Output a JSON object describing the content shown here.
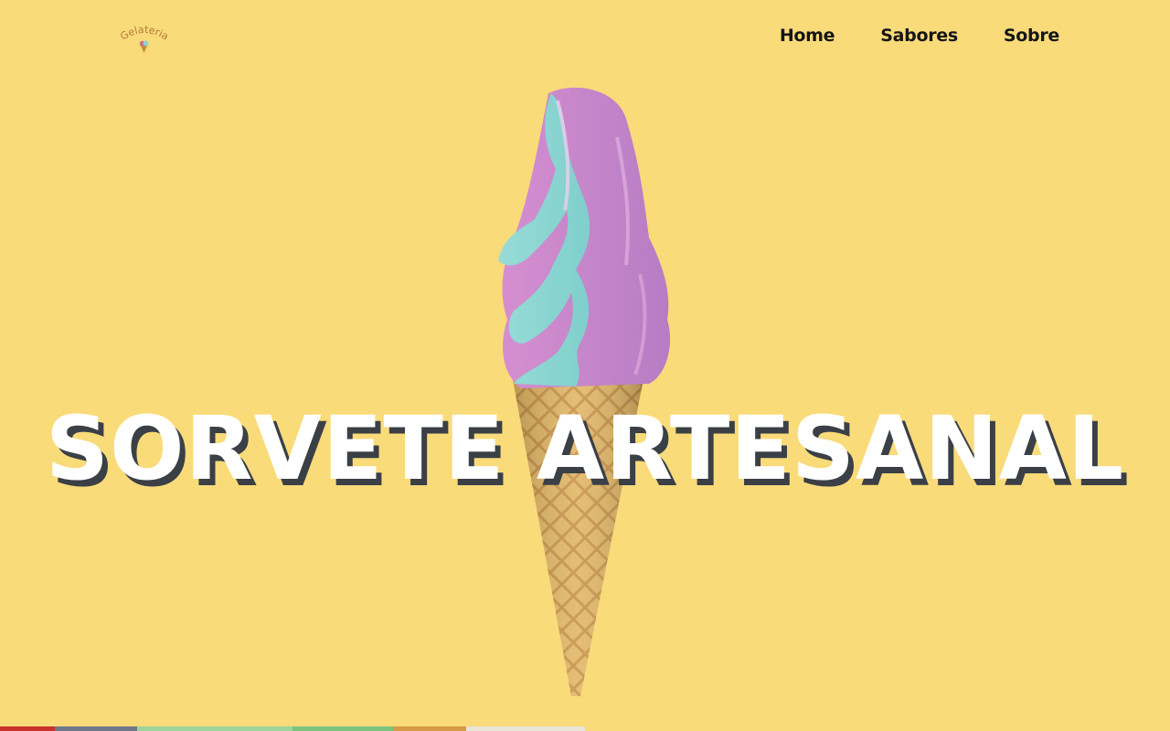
{
  "header": {
    "logo_text": "Gelateria",
    "nav": [
      {
        "label": "Home"
      },
      {
        "label": "Sabores"
      },
      {
        "label": "Sobre"
      }
    ]
  },
  "hero": {
    "title": "SORVETE ARTESANAL",
    "image": "ice-cream-cone-image"
  },
  "colors": {
    "background": "#f9db7a",
    "title": "#ffffff",
    "title_shadow": "#3b3f46",
    "nav_text": "#161616"
  }
}
